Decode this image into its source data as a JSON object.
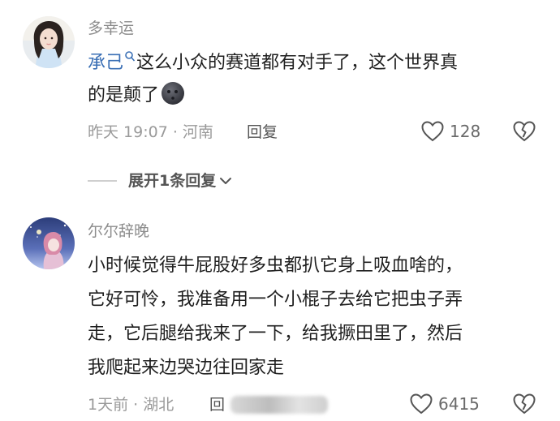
{
  "comments": [
    {
      "username": "多幸运",
      "mention": "承己",
      "text_line1": "这么小众的赛道都有对手了，这个世界真",
      "text_line2": "的是颠了",
      "emoji": "new-moon-face",
      "time": "昨天 19:07",
      "location": "河南",
      "reply_label": "回复",
      "likes": "128"
    },
    {
      "username": "尔尔辞晚",
      "text_lines": [
        "小时候觉得牛屁股好多虫都扒它身上吸血啥的，",
        "它好可怜，我准备用一个小棍子去给它把虫子弄",
        "走，它后腿给我来了一下，给我撅田里了，然后",
        "我爬起来边哭边往回家走"
      ],
      "time": "1天前",
      "location": "湖北",
      "reply_label": "回",
      "likes": "6415"
    }
  ],
  "expand_replies_label": "展开1条回复",
  "meta_separator": " · ",
  "colors": {
    "mention": "#3a6fb5",
    "meta": "#9a9a9a",
    "username": "#8c8c8c"
  }
}
